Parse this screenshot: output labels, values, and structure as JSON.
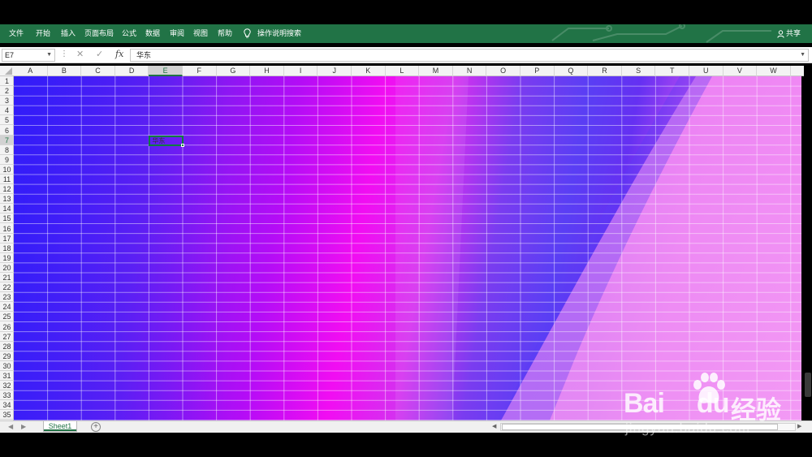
{
  "ribbon": {
    "tabs": [
      "文件",
      "开始",
      "插入",
      "页面布局",
      "公式",
      "数据",
      "审阅",
      "视图",
      "帮助"
    ],
    "search_label": "操作说明搜索",
    "share_label": "共享"
  },
  "formula_bar": {
    "name_box": "E7",
    "fx_label": "fx",
    "content": "华东"
  },
  "sheet": {
    "columns": [
      "A",
      "B",
      "C",
      "D",
      "E",
      "F",
      "G",
      "H",
      "I",
      "J",
      "K",
      "L",
      "M",
      "N",
      "O",
      "P",
      "Q",
      "R",
      "S",
      "T",
      "U",
      "V",
      "W"
    ],
    "rows": [
      "1",
      "2",
      "3",
      "4",
      "5",
      "6",
      "7",
      "8",
      "9",
      "10",
      "11",
      "12",
      "13",
      "14",
      "15",
      "16",
      "17",
      "18",
      "19",
      "20",
      "21",
      "22",
      "23",
      "24",
      "25",
      "26",
      "27",
      "28",
      "29",
      "30",
      "31",
      "32",
      "33",
      "34",
      "35"
    ],
    "selected_column": "E",
    "selected_row": "7",
    "active_cell_value": "华东"
  },
  "tabs": {
    "sheets": [
      "Sheet1"
    ],
    "add_label": "+"
  },
  "watermark": {
    "brand": "Bai",
    "brand_du": "du",
    "jingyan": "经验",
    "url": "jingyan.baidu.com"
  },
  "icons": {
    "bulb": "lightbulb-icon",
    "share": "person-icon",
    "cancel": "cancel-icon",
    "confirm": "check-icon"
  },
  "colors": {
    "ribbon": "#217346",
    "active_cell_border": "#107c41"
  }
}
